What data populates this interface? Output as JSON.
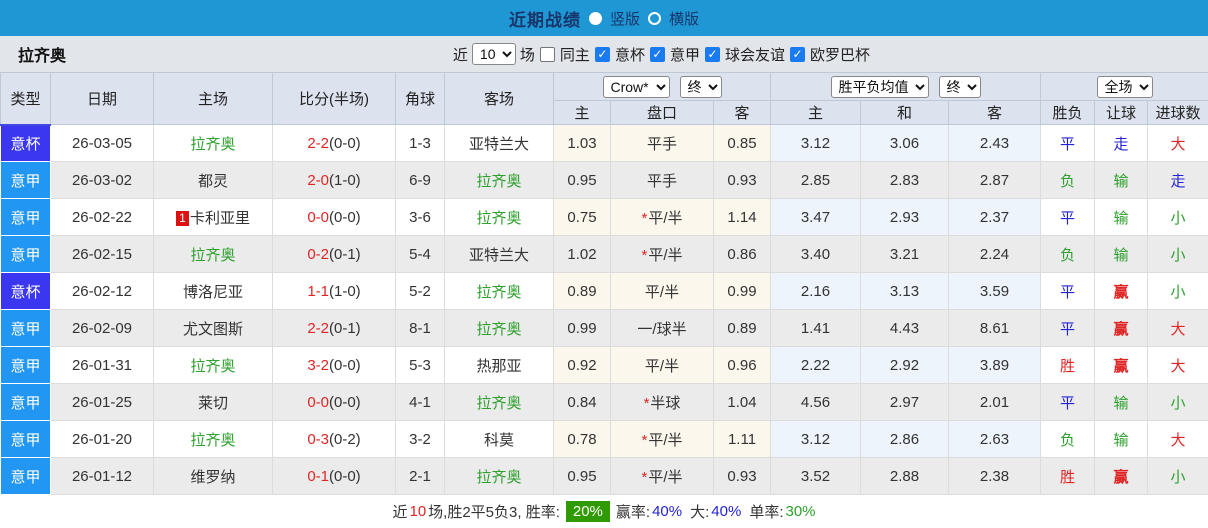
{
  "topbar": {
    "title": "近期战绩",
    "radio_vertical": "竖版",
    "radio_horizontal": "横版"
  },
  "filter": {
    "team": "拉齐奥",
    "near_label": "近",
    "matches_value": "10",
    "matches_label": "场",
    "same_home_label": "同主",
    "checkboxes": [
      "意杯",
      "意甲",
      "球会友谊",
      "欧罗巴杯"
    ]
  },
  "table": {
    "headers": {
      "type": "类型",
      "date": "日期",
      "home": "主场",
      "score": "比分(半场)",
      "corner": "角球",
      "away": "客场"
    },
    "selects": {
      "odds_company": "Crow*",
      "odds_time1": "终",
      "avg_mode": "胜平负均值",
      "odds_time2": "终",
      "scope": "全场"
    },
    "sub_headers": [
      "主",
      "盘口",
      "客",
      "主",
      "和",
      "客",
      "胜负",
      "让球",
      "进球数"
    ],
    "rows": [
      {
        "type": "意杯",
        "type_key": "cup",
        "date": "26-03-05",
        "home": "拉齐奥",
        "home_green": true,
        "home_badge": "",
        "score": "2-2",
        "half": "(0-0)",
        "corner": "1-3",
        "away": "亚特兰大",
        "away_green": false,
        "o_home": "1.03",
        "handicap": "平手",
        "star": false,
        "o_away": "0.85",
        "avg_home": "3.12",
        "avg_draw": "3.06",
        "avg_away": "2.43",
        "result": [
          "平",
          "blue"
        ],
        "let_ball": [
          "走",
          "blue"
        ],
        "goals": [
          "大",
          "red"
        ]
      },
      {
        "type": "意甲",
        "type_key": "league",
        "date": "26-03-02",
        "home": "都灵",
        "home_green": false,
        "home_badge": "",
        "score": "2-0",
        "half": "(1-0)",
        "corner": "6-9",
        "away": "拉齐奥",
        "away_green": true,
        "o_home": "0.95",
        "handicap": "平手",
        "star": false,
        "o_away": "0.93",
        "avg_home": "2.85",
        "avg_draw": "2.83",
        "avg_away": "2.87",
        "result": [
          "负",
          "green"
        ],
        "let_ball": [
          "输",
          "green"
        ],
        "goals": [
          "走",
          "blue"
        ]
      },
      {
        "type": "意甲",
        "type_key": "league",
        "date": "26-02-22",
        "home": "卡利亚里",
        "home_green": false,
        "home_badge": "1",
        "score": "0-0",
        "half": "(0-0)",
        "corner": "3-6",
        "away": "拉齐奥",
        "away_green": true,
        "o_home": "0.75",
        "handicap": "平/半",
        "star": true,
        "o_away": "1.14",
        "avg_home": "3.47",
        "avg_draw": "2.93",
        "avg_away": "2.37",
        "result": [
          "平",
          "blue"
        ],
        "let_ball": [
          "输",
          "green"
        ],
        "goals": [
          "小",
          "green"
        ]
      },
      {
        "type": "意甲",
        "type_key": "league",
        "date": "26-02-15",
        "home": "拉齐奥",
        "home_green": true,
        "home_badge": "",
        "score": "0-2",
        "half": "(0-1)",
        "corner": "5-4",
        "away": "亚特兰大",
        "away_green": false,
        "o_home": "1.02",
        "handicap": "平/半",
        "star": true,
        "o_away": "0.86",
        "avg_home": "3.40",
        "avg_draw": "3.21",
        "avg_away": "2.24",
        "result": [
          "负",
          "green"
        ],
        "let_ball": [
          "输",
          "green"
        ],
        "goals": [
          "小",
          "green"
        ]
      },
      {
        "type": "意杯",
        "type_key": "cup",
        "date": "26-02-12",
        "home": "博洛尼亚",
        "home_green": false,
        "home_badge": "",
        "score": "1-1",
        "half": "(1-0)",
        "corner": "5-2",
        "away": "拉齐奥",
        "away_green": true,
        "o_home": "0.89",
        "handicap": "平/半",
        "star": false,
        "o_away": "0.99",
        "avg_home": "2.16",
        "avg_draw": "3.13",
        "avg_away": "3.59",
        "result": [
          "平",
          "blue"
        ],
        "let_ball": [
          "赢",
          "red"
        ],
        "goals": [
          "小",
          "green"
        ]
      },
      {
        "type": "意甲",
        "type_key": "league",
        "date": "26-02-09",
        "home": "尤文图斯",
        "home_green": false,
        "home_badge": "",
        "score": "2-2",
        "half": "(0-1)",
        "corner": "8-1",
        "away": "拉齐奥",
        "away_green": true,
        "o_home": "0.99",
        "handicap": "一/球半",
        "star": false,
        "o_away": "0.89",
        "avg_home": "1.41",
        "avg_draw": "4.43",
        "avg_away": "8.61",
        "result": [
          "平",
          "blue"
        ],
        "let_ball": [
          "赢",
          "red"
        ],
        "goals": [
          "大",
          "red"
        ]
      },
      {
        "type": "意甲",
        "type_key": "league",
        "date": "26-01-31",
        "home": "拉齐奥",
        "home_green": true,
        "home_badge": "",
        "score": "3-2",
        "half": "(0-0)",
        "corner": "5-3",
        "away": "热那亚",
        "away_green": false,
        "o_home": "0.92",
        "handicap": "平/半",
        "star": false,
        "o_away": "0.96",
        "avg_home": "2.22",
        "avg_draw": "2.92",
        "avg_away": "3.89",
        "result": [
          "胜",
          "red"
        ],
        "let_ball": [
          "赢",
          "red"
        ],
        "goals": [
          "大",
          "red"
        ]
      },
      {
        "type": "意甲",
        "type_key": "league",
        "date": "26-01-25",
        "home": "莱切",
        "home_green": false,
        "home_badge": "",
        "score": "0-0",
        "half": "(0-0)",
        "corner": "4-1",
        "away": "拉齐奥",
        "away_green": true,
        "o_home": "0.84",
        "handicap": "半球",
        "star": true,
        "o_away": "1.04",
        "avg_home": "4.56",
        "avg_draw": "2.97",
        "avg_away": "2.01",
        "result": [
          "平",
          "blue"
        ],
        "let_ball": [
          "输",
          "green"
        ],
        "goals": [
          "小",
          "green"
        ]
      },
      {
        "type": "意甲",
        "type_key": "league",
        "date": "26-01-20",
        "home": "拉齐奥",
        "home_green": true,
        "home_badge": "",
        "score": "0-3",
        "half": "(0-2)",
        "corner": "3-2",
        "away": "科莫",
        "away_green": false,
        "o_home": "0.78",
        "handicap": "平/半",
        "star": true,
        "o_away": "1.11",
        "avg_home": "3.12",
        "avg_draw": "2.86",
        "avg_away": "2.63",
        "result": [
          "负",
          "green"
        ],
        "let_ball": [
          "输",
          "green"
        ],
        "goals": [
          "大",
          "red"
        ]
      },
      {
        "type": "意甲",
        "type_key": "league",
        "date": "26-01-12",
        "home": "维罗纳",
        "home_green": false,
        "home_badge": "",
        "score": "0-1",
        "half": "(0-0)",
        "corner": "2-1",
        "away": "拉齐奥",
        "away_green": true,
        "o_home": "0.95",
        "handicap": "平/半",
        "star": true,
        "o_away": "0.93",
        "avg_home": "3.52",
        "avg_draw": "2.88",
        "avg_away": "2.38",
        "result": [
          "胜",
          "red"
        ],
        "let_ball": [
          "赢",
          "red"
        ],
        "goals": [
          "小",
          "green"
        ]
      }
    ]
  },
  "footer": {
    "prefix": "近",
    "count": "10",
    "summary": "场,胜2平5负3, 胜率:",
    "win_rate": "20%",
    "profit_label": "赢率:",
    "profit_value": "40%",
    "big_label": "大:",
    "big_value": "40%",
    "single_label": "单率:",
    "single_value": "30%"
  }
}
